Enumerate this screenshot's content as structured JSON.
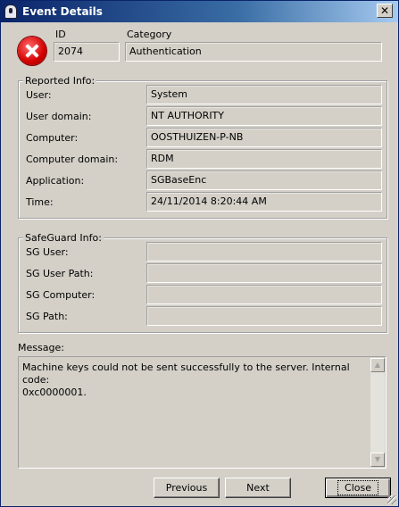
{
  "window": {
    "title": "Event Details"
  },
  "header": {
    "id_label": "ID",
    "id_value": "2074",
    "category_label": "Category",
    "category_value": "Authentication"
  },
  "reported": {
    "legend": "Reported Info:",
    "rows": [
      {
        "label": "User:",
        "value": "System"
      },
      {
        "label": "User domain:",
        "value": "NT AUTHORITY"
      },
      {
        "label": "Computer:",
        "value": "OOSTHUIZEN-P-NB"
      },
      {
        "label": "Computer domain:",
        "value": "RDM"
      },
      {
        "label": "Application:",
        "value": "SGBaseEnc"
      },
      {
        "label": "Time:",
        "value": "24/11/2014 8:20:44 AM"
      }
    ]
  },
  "safeguard": {
    "legend": "SafeGuard Info:",
    "rows": [
      {
        "label": "SG User:",
        "value": ""
      },
      {
        "label": "SG User Path:",
        "value": ""
      },
      {
        "label": "SG Computer:",
        "value": ""
      },
      {
        "label": "SG Path:",
        "value": ""
      }
    ]
  },
  "message": {
    "label": "Message:",
    "text": "Machine keys could not be sent successfully to the server. Internal code:\n0xc0000001."
  },
  "buttons": {
    "previous": "Previous",
    "next": "Next",
    "close": "Close"
  },
  "icons": {
    "title_icon": "shield-lock-icon",
    "error_icon": "error-icon",
    "close_icon": "close-icon"
  },
  "colors": {
    "titlebar": "#0a246a",
    "dialog_bg": "#d4d0c8",
    "error_red": "#d40000"
  }
}
